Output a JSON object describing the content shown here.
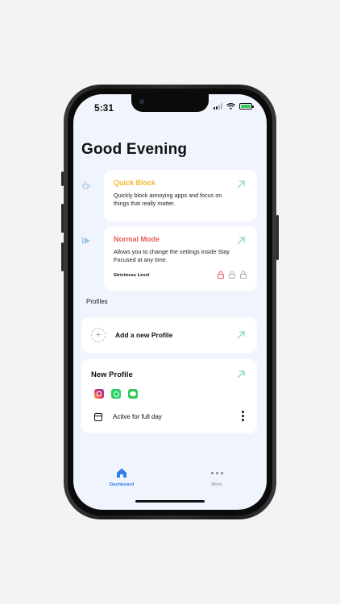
{
  "status_bar": {
    "time": "5:31"
  },
  "greeting": "Good Evening",
  "modes": {
    "quick_block": {
      "title": "Quick Block",
      "description": "Quickly block annoying apps and focus on things that really matter.",
      "title_color": "#f5b82e"
    },
    "normal_mode": {
      "title": "Normal Mode",
      "description": "Allows you to change the settings inside Stay Focused at any time.",
      "title_color": "#e9605b",
      "strictness_label": "Strictness Level",
      "strictness_level": 1,
      "strictness_max": 3
    }
  },
  "profiles": {
    "section_label": "Profiles",
    "add_label": "Add a new Profile",
    "items": [
      {
        "name": "New Profile",
        "apps": [
          "instagram-icon",
          "whatsapp-icon",
          "messages-icon"
        ],
        "schedule": "Active for full day"
      }
    ]
  },
  "tabbar": {
    "dashboard_label": "Dashboard",
    "more_label": "More"
  },
  "colors": {
    "accent": "#2f7ee6",
    "arrow": "#8fd3c6",
    "background": "#f0f4fc",
    "lock_active": "#e9605b",
    "lock_inactive": "#a8adb6"
  }
}
